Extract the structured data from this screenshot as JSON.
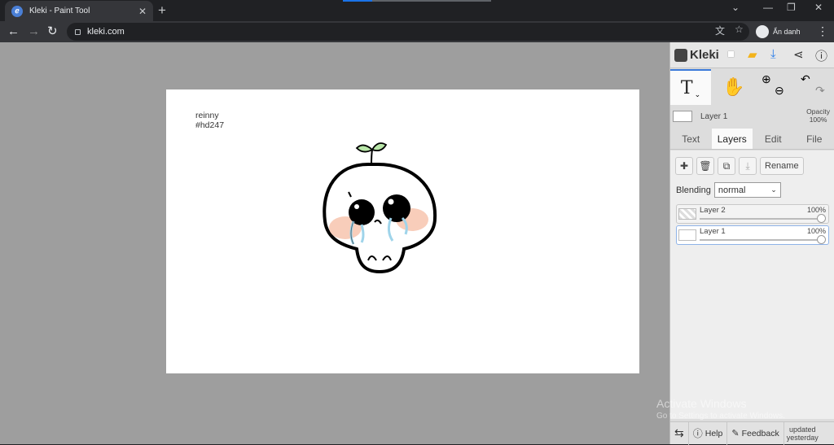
{
  "browser": {
    "tab_title": "Kleki - Paint Tool",
    "url": "kleki.com",
    "profile_label": "Ẩn danh"
  },
  "canvas": {
    "caption_line1": "reinny",
    "caption_line2": "#hd247"
  },
  "panel": {
    "logo": "Kleki",
    "current_layer": "Layer 1",
    "opacity_label": "Opacity",
    "opacity_value": "100%",
    "tabs": [
      {
        "label": "Text"
      },
      {
        "label": "Layers"
      },
      {
        "label": "Edit"
      },
      {
        "label": "File"
      }
    ],
    "rename_label": "Rename",
    "blending_label": "Blending",
    "blending_value": "normal",
    "layers": [
      {
        "name": "Layer 2",
        "opacity": "100%"
      },
      {
        "name": "Layer 1",
        "opacity": "100%"
      }
    ],
    "help_label": "Help",
    "feedback_label": "Feedback",
    "updated_line1": "updated",
    "updated_line2": "yesterday"
  },
  "os_watermark": {
    "title": "Activate Windows",
    "subtitle": "Go to Settings to activate Windows."
  },
  "colors": {
    "accent": "#3b7ad9",
    "canvas_bg": "#9e9e9e"
  }
}
